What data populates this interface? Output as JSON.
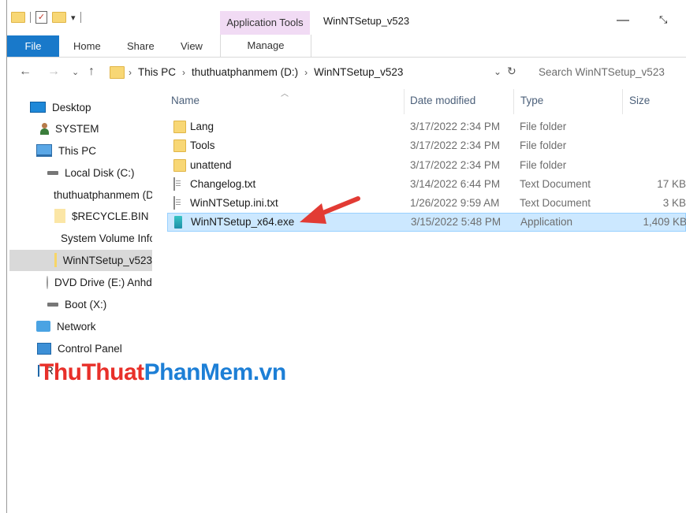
{
  "titlebar": {
    "context_tab": "Application Tools",
    "window_title": "WinNTSetup_v523",
    "minimize_glyph": "—",
    "maximize_glyph": "⤡"
  },
  "ribbon": {
    "tabs": [
      "File",
      "Home",
      "Share",
      "View",
      "Manage"
    ],
    "file_color": "#1979ca",
    "context_color": "#f1dbf4"
  },
  "address": {
    "crumbs": [
      "This PC",
      "thuthuatphanmem (D:)",
      "WinNTSetup_v523"
    ],
    "search_placeholder": "Search WinNTSetup_v523"
  },
  "nav_pane": {
    "items": [
      {
        "label": "Desktop",
        "icon": "desktop-icon"
      },
      {
        "label": "SYSTEM",
        "icon": "user-icon"
      },
      {
        "label": "This PC",
        "icon": "this-pc-icon"
      },
      {
        "label": "Local Disk (C:)",
        "icon": "drive-icon"
      },
      {
        "label": "thuthuatphanmem (D:)",
        "icon": "drive-icon"
      },
      {
        "label": "$RECYCLE.BIN",
        "icon": "folder-icon"
      },
      {
        "label": "System Volume Information",
        "icon": "folder-icon"
      },
      {
        "label": "WinNTSetup_v523",
        "icon": "folder-icon"
      },
      {
        "label": "DVD Drive (E:) Anhdv",
        "icon": "dvd-icon"
      },
      {
        "label": "Boot (X:)",
        "icon": "drive-icon"
      },
      {
        "label": "Network",
        "icon": "network-icon"
      },
      {
        "label": "Control Panel",
        "icon": "control-panel-icon"
      },
      {
        "label": "Recycle Bin",
        "icon": "recycle-bin-icon"
      }
    ],
    "selected_index": 7
  },
  "file_list": {
    "headers": {
      "name": "Name",
      "date": "Date modified",
      "type": "Type",
      "size": "Size"
    },
    "rows": [
      {
        "name": "Lang",
        "date": "3/17/2022 2:34 PM",
        "type": "File folder",
        "size": "",
        "icon": "folder-icon"
      },
      {
        "name": "Tools",
        "date": "3/17/2022 2:34 PM",
        "type": "File folder",
        "size": "",
        "icon": "folder-icon"
      },
      {
        "name": "unattend",
        "date": "3/17/2022 2:34 PM",
        "type": "File folder",
        "size": "",
        "icon": "folder-icon"
      },
      {
        "name": "Changelog.txt",
        "date": "3/14/2022 6:44 PM",
        "type": "Text Document",
        "size": "17 KB",
        "icon": "text-file-icon"
      },
      {
        "name": "WinNTSetup.ini.txt",
        "date": "1/26/2022 9:59 AM",
        "type": "Text Document",
        "size": "3 KB",
        "icon": "text-file-icon"
      },
      {
        "name": "WinNTSetup_x64.exe",
        "date": "3/15/2022 5:48 PM",
        "type": "Application",
        "size": "1,409 KB",
        "icon": "exe-icon"
      }
    ],
    "selected_index": 5
  },
  "watermark": {
    "part1": "ThuThuat",
    "part2": "PhanMem.vn"
  },
  "colors": {
    "selection": "#cce8ff",
    "arrow": "#e23b34",
    "header_text": "#4c607a"
  }
}
